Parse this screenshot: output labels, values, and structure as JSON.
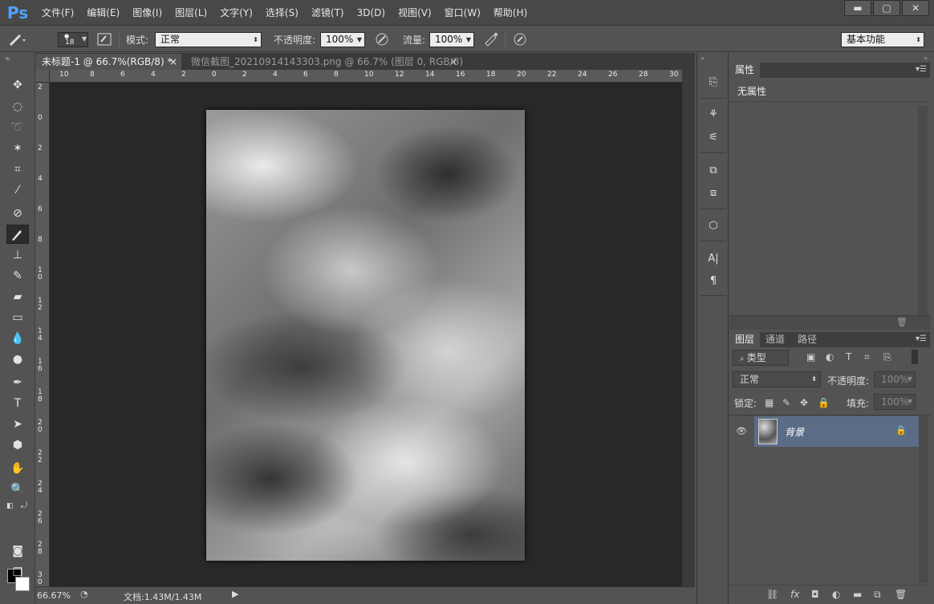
{
  "app": {
    "logo": "Ps"
  },
  "menu": [
    "文件(F)",
    "编辑(E)",
    "图像(I)",
    "图层(L)",
    "文字(Y)",
    "选择(S)",
    "滤镜(T)",
    "3D(D)",
    "视图(V)",
    "窗口(W)",
    "帮助(H)"
  ],
  "window_controls": {
    "minimize": "▬",
    "maximize": "▢",
    "close": "✕"
  },
  "options": {
    "brush_size": "18",
    "mode_label": "模式:",
    "mode_value": "正常",
    "opacity_label": "不透明度:",
    "opacity_value": "100%",
    "flow_label": "流量:",
    "flow_value": "100%",
    "workspace": "基本功能"
  },
  "tabs": [
    {
      "label": "未标题-1 @ 66.7%(RGB/8) *",
      "close": "×"
    },
    {
      "label": "微信截图_20210914143303.png @ 66.7% (图层 0, RGB/8)",
      "close": "×"
    }
  ],
  "ruler_h": [
    "10",
    "8",
    "6",
    "4",
    "2",
    "0",
    "2",
    "4",
    "6",
    "8",
    "10",
    "12",
    "14",
    "16",
    "18",
    "20",
    "22",
    "24",
    "26",
    "28",
    "30"
  ],
  "ruler_v": [
    "2",
    "0",
    "2",
    "4",
    "6",
    "8",
    "1 0",
    "1 2",
    "1 4",
    "1 6",
    "1 8",
    "2 0",
    "2 2",
    "2 4",
    "2 6",
    "2 8",
    "3 0"
  ],
  "status": {
    "zoom": "66.67%",
    "doc": "文档:1.43M/1.43M"
  },
  "properties": {
    "tab": "属性",
    "content": "无属性"
  },
  "layers": {
    "tabs": [
      "图层",
      "通道",
      "路径"
    ],
    "filter": "类型",
    "blend_mode": "正常",
    "opacity_label": "不透明度:",
    "opacity_value": "100%",
    "lock_label": "锁定:",
    "fill_label": "填充:",
    "fill_value": "100%",
    "items": [
      {
        "name": "背景"
      }
    ]
  },
  "colors": {
    "accent": "#4da3ff",
    "selected_layer": "#5b6d86"
  }
}
